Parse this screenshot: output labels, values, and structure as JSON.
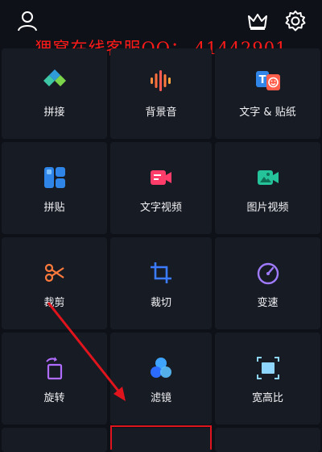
{
  "watermark": "狸窝在线客服QQ： 41442901",
  "topbar": {
    "profile_icon": "user-icon",
    "vip_icon": "crown-icon",
    "settings_icon": "gear-icon"
  },
  "tools": [
    {
      "label": "拼接",
      "icon": "splice-icon"
    },
    {
      "label": "背景音",
      "icon": "audio-wave-icon"
    },
    {
      "label": "文字 & 贴纸",
      "icon": "text-sticker-icon"
    },
    {
      "label": "拼贴",
      "icon": "collage-icon"
    },
    {
      "label": "文字视频",
      "icon": "text-video-icon"
    },
    {
      "label": "图片视频",
      "icon": "photo-video-icon"
    },
    {
      "label": "裁剪",
      "icon": "scissors-icon"
    },
    {
      "label": "裁切",
      "icon": "crop-icon"
    },
    {
      "label": "变速",
      "icon": "speedometer-icon"
    },
    {
      "label": "旋转",
      "icon": "rotate-icon"
    },
    {
      "label": "滤镜",
      "icon": "filter-icon"
    },
    {
      "label": "宽高比",
      "icon": "aspect-ratio-icon"
    }
  ],
  "colors": {
    "background": "#0e1117",
    "cell": "#171b24",
    "annotation_red": "#e0141c"
  }
}
